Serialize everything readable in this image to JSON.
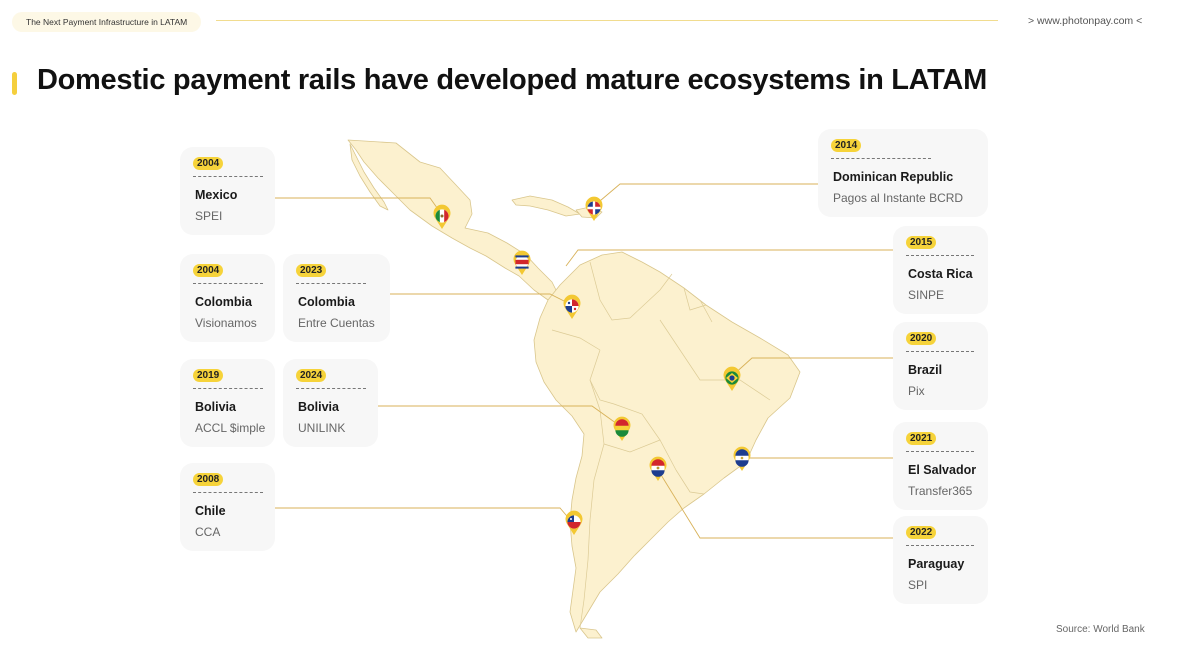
{
  "header": {
    "tag": "The Next Payment Infrastructure in LATAM",
    "url": "> www.photonpay.com <"
  },
  "title": "Domestic payment rails have developed mature ecosystems in LATAM",
  "source": "Source: World Bank",
  "colors": {
    "accent": "#f5cf3d",
    "land": "#fcf1cf",
    "border": "#d9c68c",
    "line": "#d8b25a",
    "card": "#f7f7f7"
  },
  "cards": {
    "mexico": {
      "year": "2004",
      "country": "Mexico",
      "system": "SPEI"
    },
    "colombia1": {
      "year": "2004",
      "country": "Colombia",
      "system": "Visionamos"
    },
    "colombia2": {
      "year": "2023",
      "country": "Colombia",
      "system": "Entre Cuentas"
    },
    "bolivia1": {
      "year": "2019",
      "country": "Bolivia",
      "system": "ACCL $imple"
    },
    "bolivia2": {
      "year": "2024",
      "country": "Bolivia",
      "system": "UNILINK"
    },
    "chile": {
      "year": "2008",
      "country": "Chile",
      "system": "CCA"
    },
    "dominican": {
      "year": "2014",
      "country": "Dominican Republic",
      "system": "Pagos al Instante BCRD"
    },
    "costarica": {
      "year": "2015",
      "country": "Costa Rica",
      "system": "SINPE"
    },
    "brazil": {
      "year": "2020",
      "country": "Brazil",
      "system": "Pix"
    },
    "elsalvador": {
      "year": "2021",
      "country": "El Salvador",
      "system": "Transfer365"
    },
    "paraguay": {
      "year": "2022",
      "country": "Paraguay",
      "system": "SPI"
    }
  },
  "markers": {
    "mexico": "mexico-flag-icon",
    "dominican": "dominican-republic-flag-icon",
    "costarica": "costa-rica-flag-icon",
    "panama": "panama-flag-icon",
    "brazil": "brazil-flag-icon",
    "bolivia": "bolivia-flag-icon",
    "paraguay": "paraguay-flag-icon",
    "elsalvador": "el-salvador-flag-icon",
    "chile": "chile-flag-icon"
  }
}
